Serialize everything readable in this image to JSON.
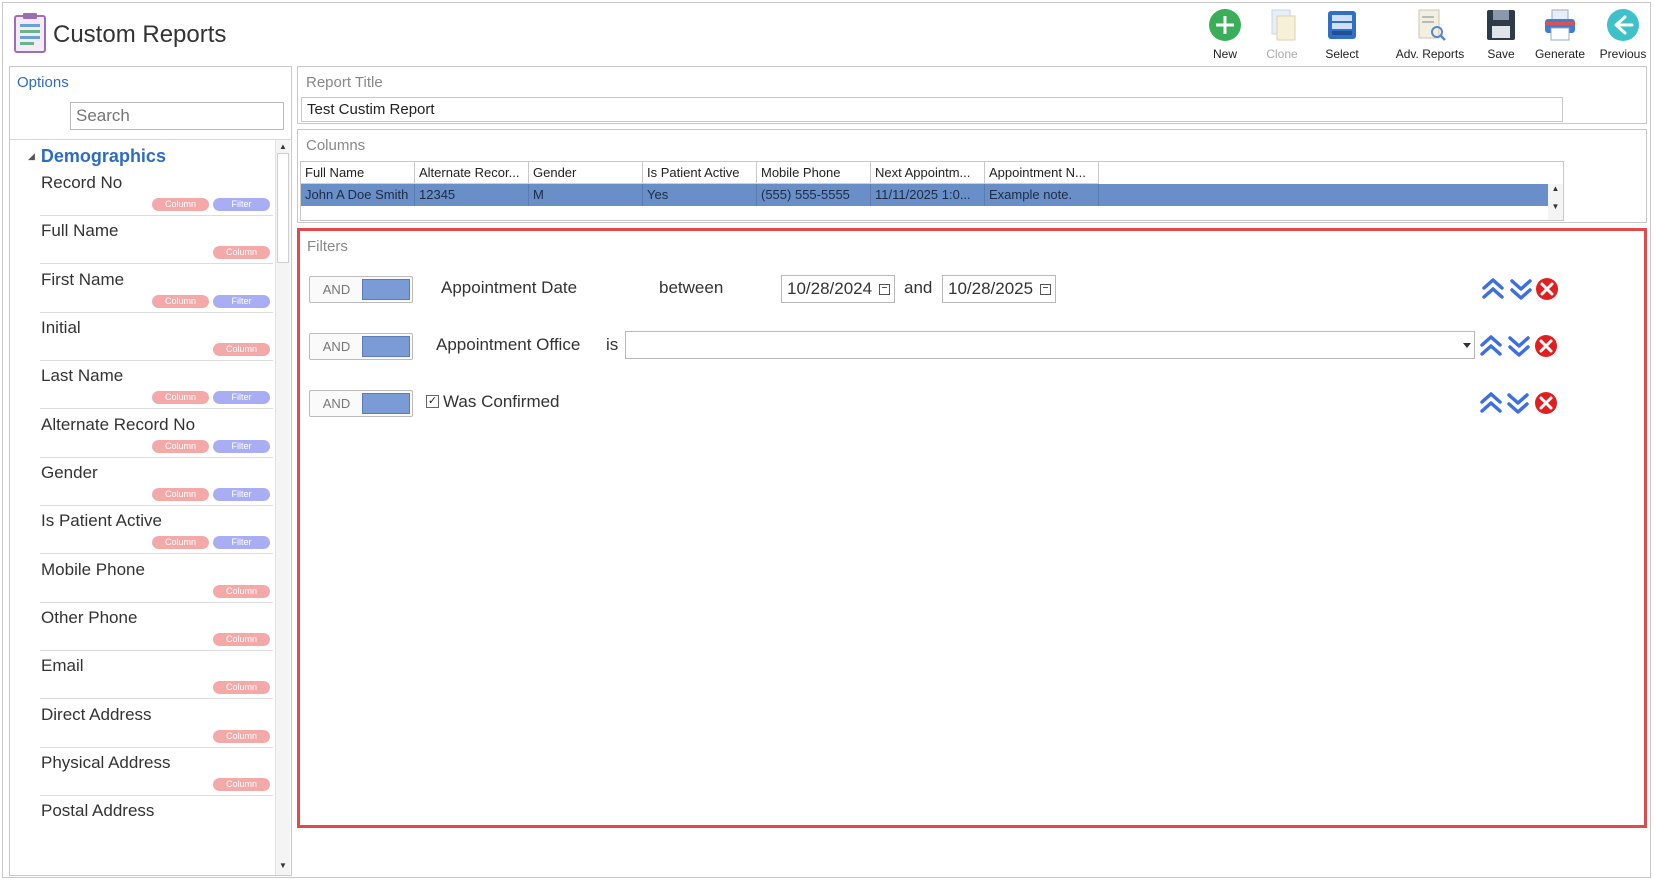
{
  "header": {
    "title": "Custom Reports"
  },
  "toolbar": {
    "new": "New",
    "clone": "Clone",
    "select": "Select",
    "adv_reports": "Adv. Reports",
    "save": "Save",
    "generate": "Generate",
    "previous": "Previous"
  },
  "options": {
    "title": "Options",
    "search_placeholder": "Search",
    "group": "Demographics",
    "column_tag": "Column",
    "filter_tag": "Filter",
    "items": [
      {
        "label": "Record No"
      },
      {
        "label": "Full Name"
      },
      {
        "label": "First Name"
      },
      {
        "label": "Initial"
      },
      {
        "label": "Last Name"
      },
      {
        "label": "Alternate Record No"
      },
      {
        "label": "Gender"
      },
      {
        "label": "Is Patient Active"
      },
      {
        "label": "Mobile Phone"
      },
      {
        "label": "Other Phone"
      },
      {
        "label": "Email"
      },
      {
        "label": "Direct Address"
      },
      {
        "label": "Physical Address"
      },
      {
        "label": "Postal Address"
      }
    ]
  },
  "report_title": {
    "label": "Report Title",
    "value": "Test Custim Report"
  },
  "columns": {
    "label": "Columns",
    "headers": [
      "Full Name",
      "Alternate Recor...",
      "Gender",
      "Is Patient Active",
      "Mobile Phone",
      "Next Appointm...",
      "Appointment N..."
    ],
    "row": [
      "John A Doe Smith",
      "12345",
      "M",
      "Yes",
      "(555) 555-5555",
      "11/11/2025 1:0...",
      "Example note."
    ]
  },
  "filters": {
    "label": "Filters",
    "and_label": "AND",
    "rows": [
      {
        "field": "Appointment Date",
        "op": "between",
        "from": "10/28/2024",
        "joiner": "and",
        "to": "10/28/2025"
      },
      {
        "field": "Appointment Office",
        "op": "is",
        "value": ""
      },
      {
        "field": "Was Confirmed",
        "checked": "✓"
      }
    ]
  }
}
